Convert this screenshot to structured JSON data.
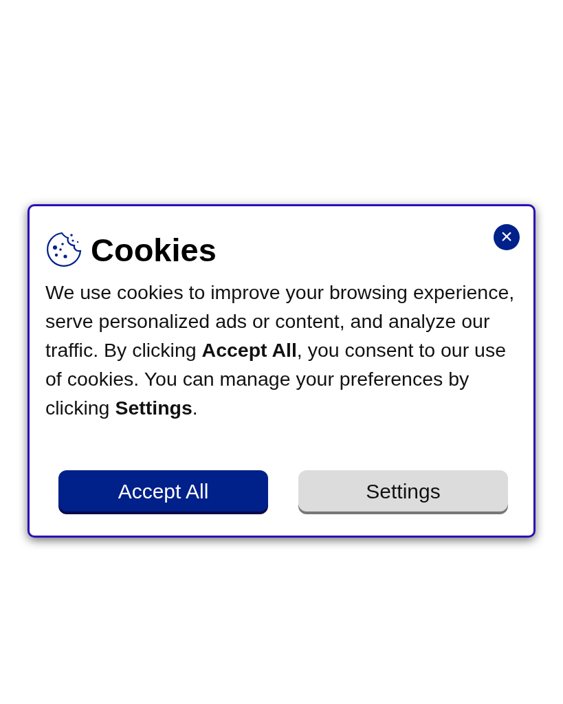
{
  "dialog": {
    "title": "Cookies",
    "close": "×",
    "message": "We use cookies to improve your browsing experience, serve personalized ads or content, and analyze our traffic. By clicking **Accept All**, you consent to our use of cookies. You can manage your preferences by clicking **Settings**.",
    "buttons": [
      {
        "label": "Accept All",
        "kind": "primary"
      },
      {
        "label": "Settings",
        "kind": "secondary"
      }
    ]
  }
}
